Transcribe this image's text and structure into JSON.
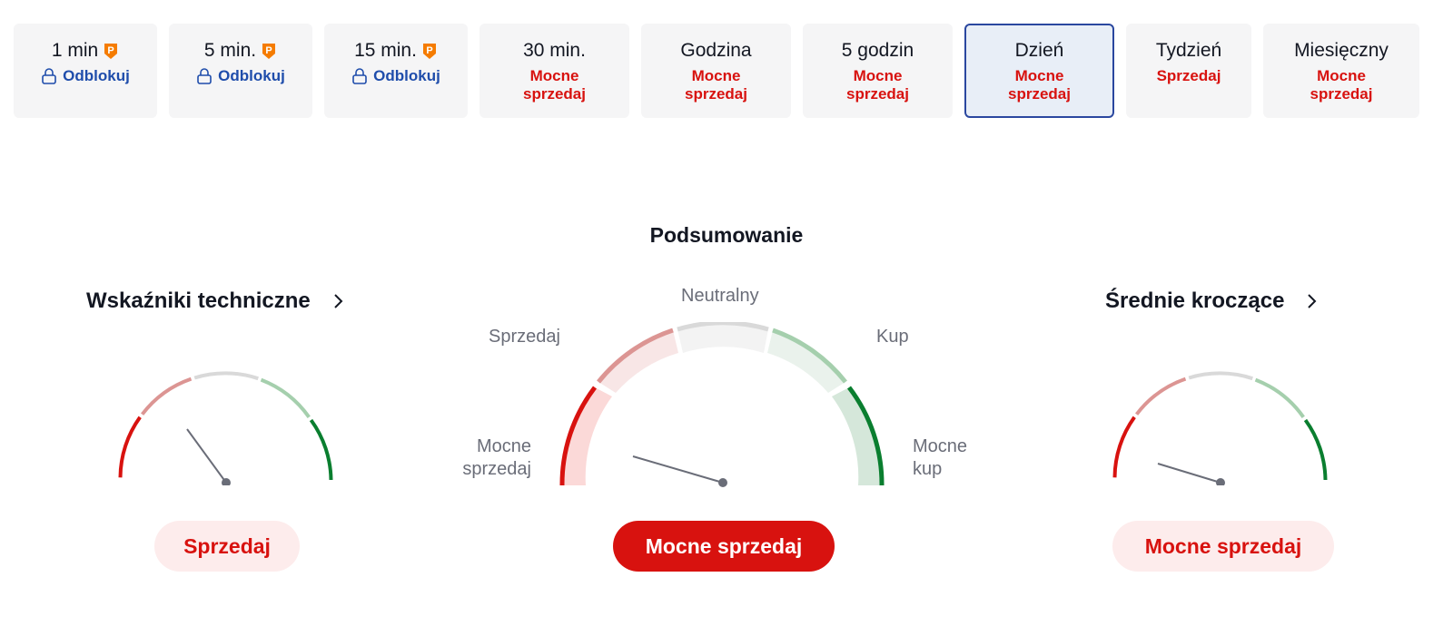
{
  "tabs": [
    {
      "label": "1 min",
      "locked": true,
      "unlock_label": "Odblokuj"
    },
    {
      "label": "5 min.",
      "locked": true,
      "unlock_label": "Odblokuj"
    },
    {
      "label": "15 min.",
      "locked": true,
      "unlock_label": "Odblokuj"
    },
    {
      "label": "30 min.",
      "status": "Mocne sprzedaj"
    },
    {
      "label": "Godzina",
      "status": "Mocne sprzedaj"
    },
    {
      "label": "5 godzin",
      "status": "Mocne sprzedaj"
    },
    {
      "label": "Dzień",
      "status": "Mocne sprzedaj",
      "active": true
    },
    {
      "label": "Tydzień",
      "status": "Sprzedaj"
    },
    {
      "label": "Miesięczny",
      "status": "Mocne sprzedaj"
    }
  ],
  "summary": {
    "title": "Podsumowanie",
    "labels": {
      "neutral": "Neutralny",
      "sell": "Sprzedaj",
      "buy": "Kup",
      "strong_sell_line1": "Mocne",
      "strong_sell_line2": "sprzedaj",
      "strong_buy_line1": "Mocne",
      "strong_buy_line2": "kup"
    },
    "result": "Mocne sprzedaj"
  },
  "technical": {
    "title": "Wskaźniki techniczne",
    "result": "Sprzedaj"
  },
  "moving_averages": {
    "title": "Średnie kroczące",
    "result": "Mocne sprzedaj"
  },
  "colors": {
    "strong_sell": "#d8120f",
    "sell": "#dc9593",
    "neutral": "#d9d9d9",
    "buy": "#a5cfad",
    "strong_buy": "#0a7e2f",
    "active_border": "#2a479f",
    "pro_badge": "#f57c00"
  },
  "icons": {
    "pro": "pro-badge-icon",
    "lock": "lock-icon",
    "chevron": "chevron-right-icon"
  }
}
